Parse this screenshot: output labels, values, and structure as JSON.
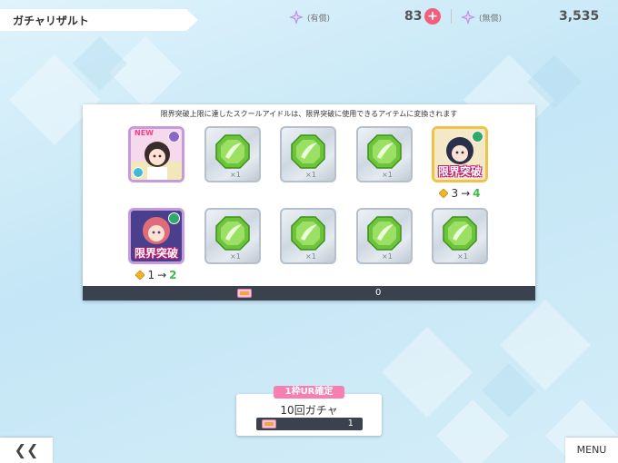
{
  "header": {
    "title": "ガチャリザルト",
    "paid_label": "(有償)",
    "paid_count": "83",
    "free_label": "(無償)",
    "free_count": "3,535",
    "plus_icon": "plus-icon",
    "currency_icon": "star-gem-icon"
  },
  "results": {
    "note": "限界突破上限に達したスクールアイドルは、限界突破に使用できるアイテムに変換されます",
    "rows": [
      [
        {
          "type": "idol",
          "tag": "NEW",
          "frame": "purple"
        },
        {
          "type": "item",
          "qty": "×1"
        },
        {
          "type": "item",
          "qty": "×1"
        },
        {
          "type": "item",
          "qty": "×1"
        },
        {
          "type": "idol",
          "limit_label": "限界突破",
          "from": "3",
          "arrow": "→",
          "to": "4",
          "frame": "gold"
        }
      ],
      [
        {
          "type": "idol",
          "limit_label": "限界突破",
          "from": "1",
          "arrow": "→",
          "to": "2",
          "frame": "gold"
        },
        {
          "type": "item",
          "qty": "×1"
        },
        {
          "type": "item",
          "qty": "×1"
        },
        {
          "type": "item",
          "qty": "×1"
        },
        {
          "type": "item",
          "qty": "×1"
        }
      ]
    ],
    "footer_count": "0"
  },
  "gacha_button": {
    "banner": "1枠UR確定",
    "label": "10回ガチャ",
    "cost": "1"
  },
  "nav": {
    "back_label": "❮❮",
    "menu_label": "MENU"
  },
  "colors": {
    "accent_pink": "#f47fb0",
    "plus_red": "#f25f7b",
    "limit_green": "#3fba4b",
    "footer_dark": "#3a4250"
  }
}
